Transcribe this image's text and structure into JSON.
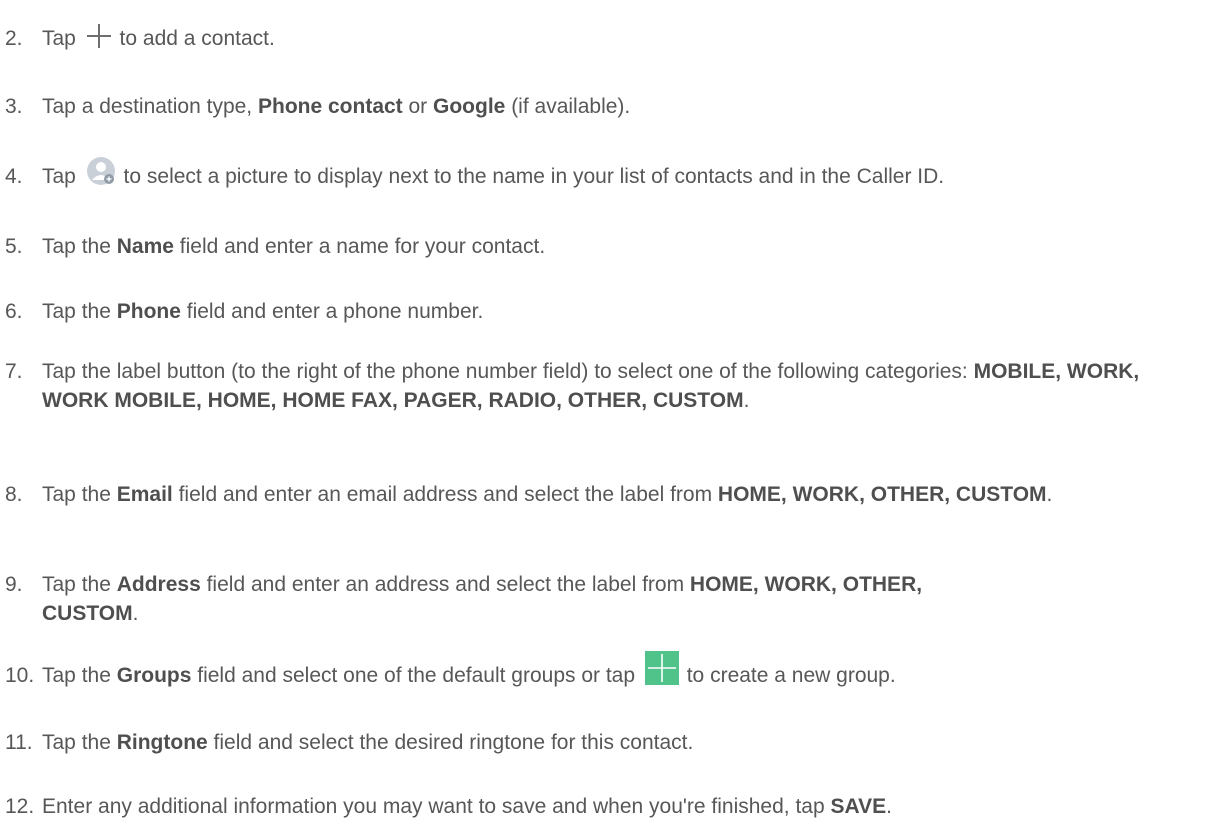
{
  "steps": [
    {
      "num": "2.",
      "parts": [
        {
          "t": "Tap "
        },
        {
          "icon": "plus-icon"
        },
        {
          "t": " to add a contact."
        }
      ]
    },
    {
      "num": "3.",
      "parts": [
        {
          "t": "Tap a destination type, "
        },
        {
          "b": "Phone contact"
        },
        {
          "t": " or "
        },
        {
          "b": "Google"
        },
        {
          "t": " (if available)."
        }
      ]
    },
    {
      "num": "4.",
      "parts": [
        {
          "t": "Tap "
        },
        {
          "icon": "contact-photo-icon"
        },
        {
          "t": " to select a picture to display next to the name in your list of contacts and in the Caller ID."
        }
      ]
    },
    {
      "num": "5.",
      "parts": [
        {
          "t": "Tap the "
        },
        {
          "b": "Name"
        },
        {
          "t": " field and enter a name for your contact."
        }
      ]
    },
    {
      "num": "6.",
      "parts": [
        {
          "t": "Tap the "
        },
        {
          "b": "Phone"
        },
        {
          "t": " field and enter a phone number."
        }
      ]
    },
    {
      "num": "7.",
      "parts": [
        {
          "t": "Tap the label button (to the right of the phone number field) to select one of the following categories: "
        },
        {
          "b": "MOBILE, WORK, WORK MOBILE, HOME, HOME FAX, PAGER, RADIO, OTHER, CUSTOM"
        },
        {
          "t": "."
        }
      ]
    },
    {
      "num": "8.",
      "parts": [
        {
          "t": "Tap the "
        },
        {
          "b": "Email"
        },
        {
          "t": " field and enter an email address and select the label from "
        },
        {
          "b": "HOME, WORK, OTHER, CUSTOM"
        },
        {
          "t": "."
        }
      ]
    },
    {
      "num": "9.",
      "parts": [
        {
          "t": "Tap the "
        },
        {
          "b": "Address"
        },
        {
          "t": " field and enter an address and select the label from "
        },
        {
          "b": "HOME, WORK, OTHER, CUSTOM"
        },
        {
          "t": "."
        }
      ]
    },
    {
      "num": "10.",
      "parts": [
        {
          "t": "Tap the "
        },
        {
          "b": "Groups"
        },
        {
          "t": " field and select one of the default groups or tap "
        },
        {
          "icon": "green-plus-icon"
        },
        {
          "t": " to create a new group."
        }
      ]
    },
    {
      "num": "11.",
      "parts": [
        {
          "t": "Tap the "
        },
        {
          "b": "Ringtone"
        },
        {
          "t": " field and select the desired ringtone for this contact."
        }
      ]
    },
    {
      "num": "12.",
      "parts": [
        {
          "t": "Enter any additional information you may want to save and when you're finished, tap "
        },
        {
          "b": "SAVE"
        },
        {
          "t": "."
        }
      ]
    }
  ],
  "colors": {
    "text": "#575757",
    "plus_stroke": "#6f6f6f",
    "avatar_bg": "#c9d0d8",
    "green": "#4fc38a"
  }
}
